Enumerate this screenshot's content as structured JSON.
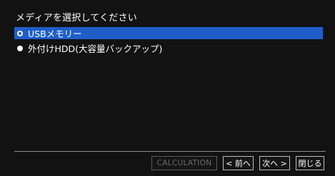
{
  "dialog": {
    "title": "メディアを選択してください",
    "options": [
      {
        "label": "USBメモリー",
        "selected": true
      },
      {
        "label": "外付けHDD(大容量バックアップ)",
        "selected": false
      }
    ],
    "buttons": {
      "calculation": "CALCULATION",
      "prev": "< 前へ",
      "next": "次へ >",
      "close": "閉じる"
    }
  },
  "colors": {
    "highlight": "#1f5ec9",
    "background": "#121212",
    "text": "#ffffff",
    "disabled": "#6a6a6a"
  }
}
